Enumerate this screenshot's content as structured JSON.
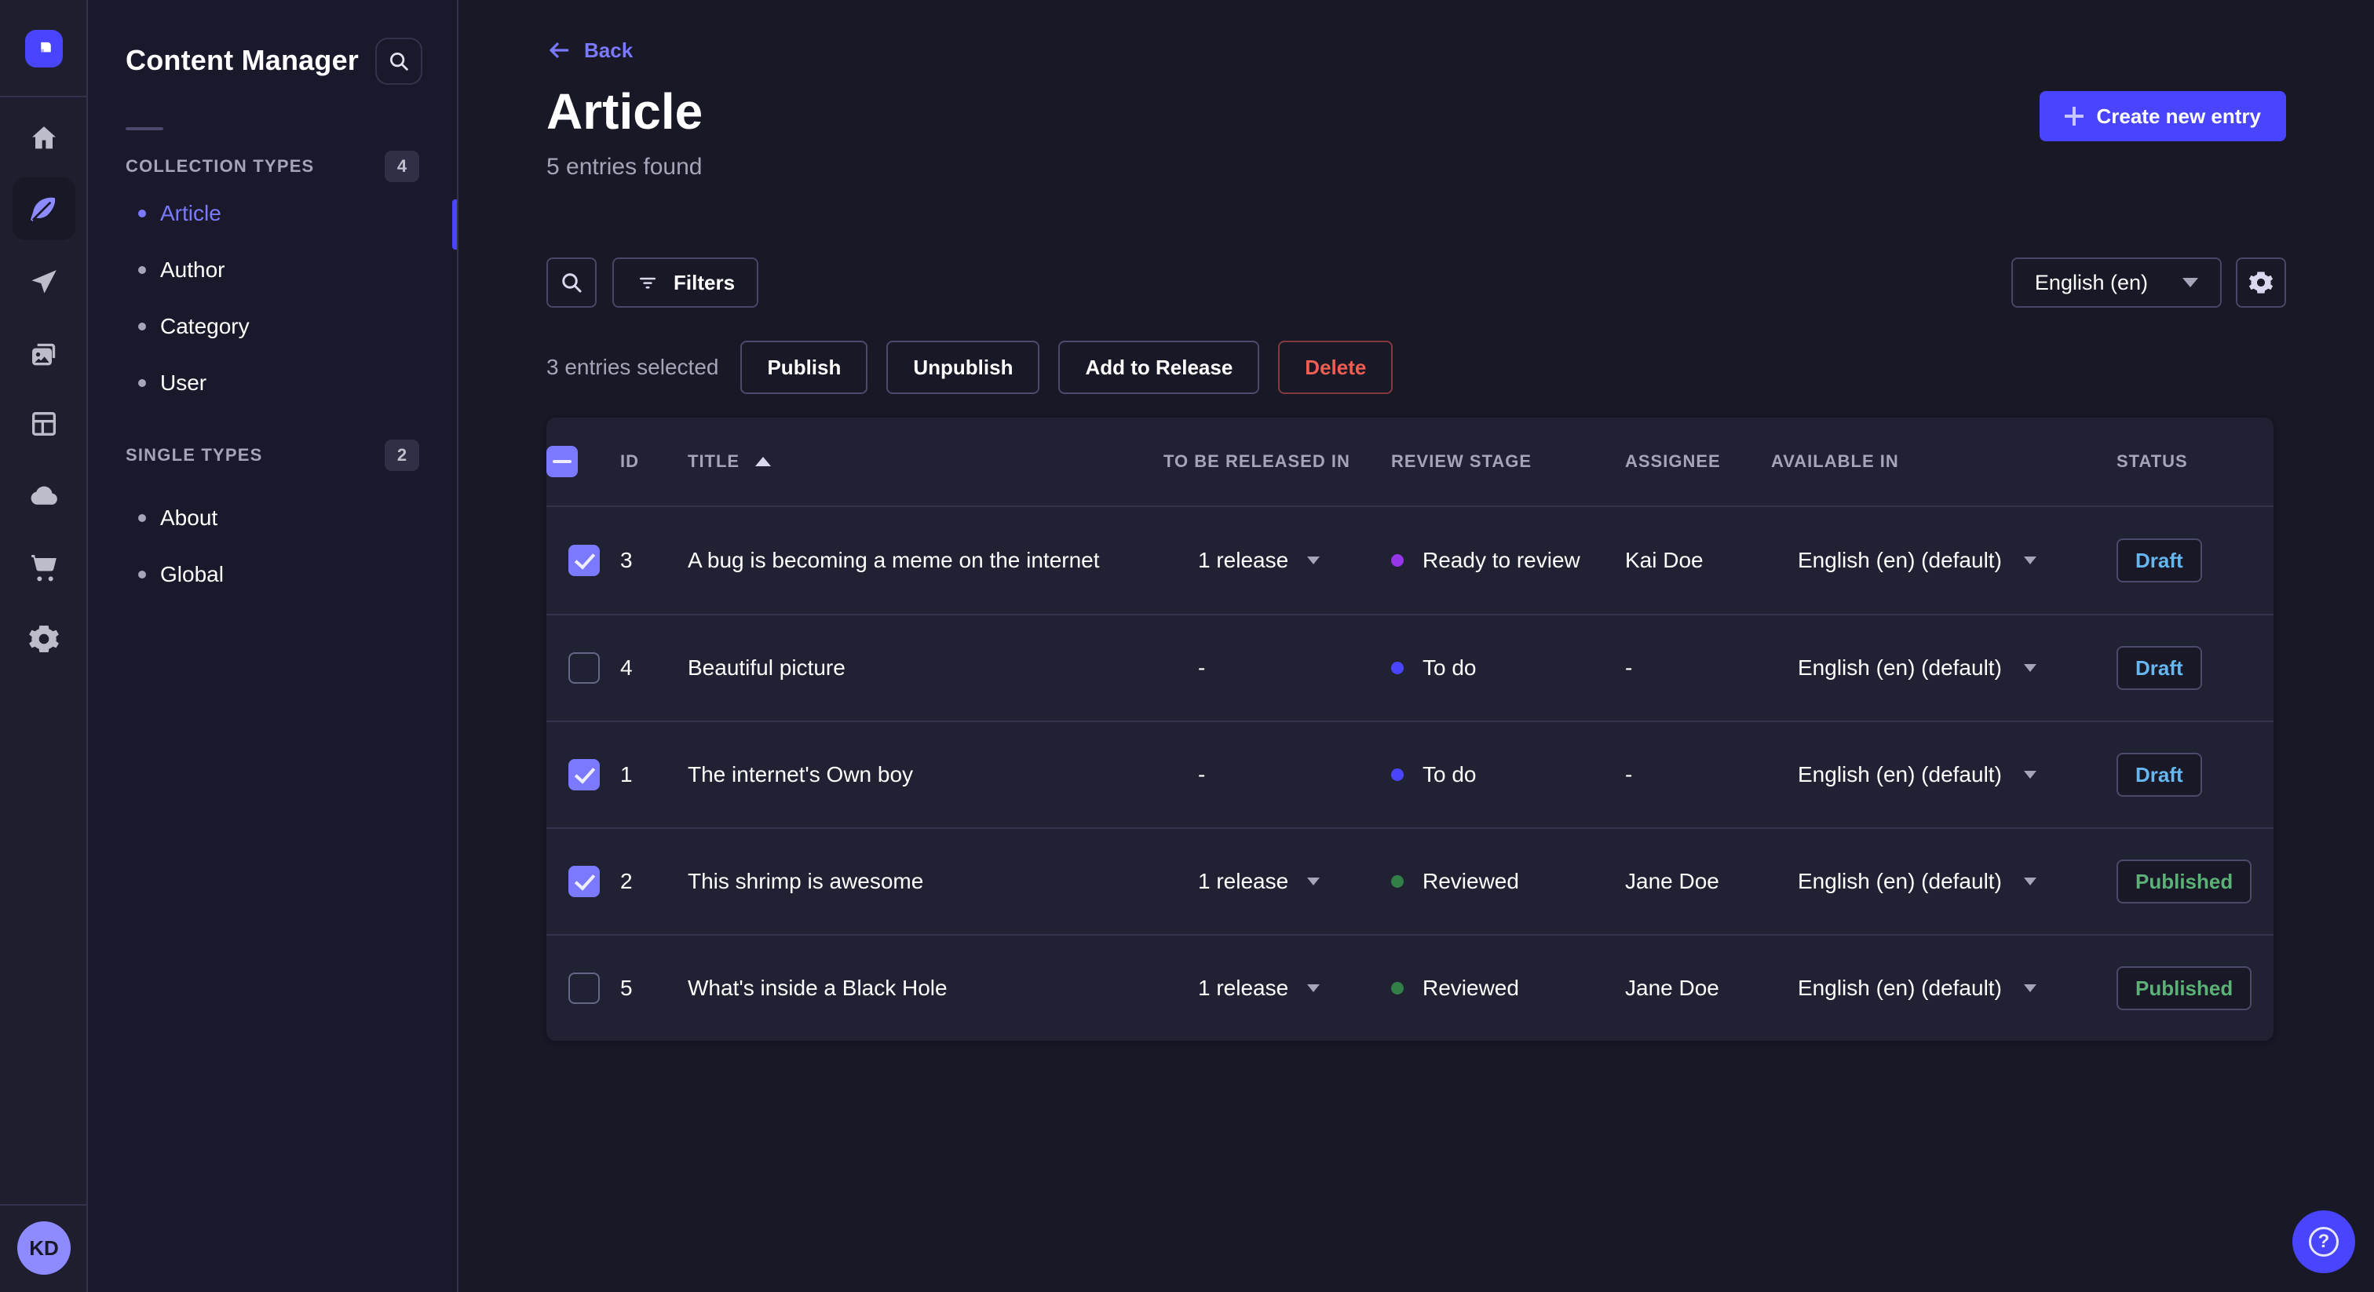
{
  "colors": {
    "accent": "#4945ff",
    "accent_light": "#7b79ff",
    "background": "#181826",
    "surface": "#212134",
    "danger": "#ee5e52",
    "success_text": "#5cb176",
    "draft_text": "#66b7f1",
    "stage_ready_to_review": "#9736e8",
    "stage_todo": "#4945ff",
    "stage_reviewed": "#328048"
  },
  "rail": {
    "icons": [
      "strapi-logo-icon",
      "home-icon",
      "feather-icon",
      "paper-plane-icon",
      "media-library-icon",
      "layout-icon",
      "cloud-icon",
      "cart-icon",
      "gear-icon"
    ],
    "active_icon": "feather-icon",
    "avatar_initials": "KD"
  },
  "sidebar": {
    "title": "Content Manager",
    "search_icon": "search-icon",
    "sections": [
      {
        "label": "COLLECTION TYPES",
        "count": "4",
        "items": [
          {
            "label": "Article",
            "active": true
          },
          {
            "label": "Author",
            "active": false
          },
          {
            "label": "Category",
            "active": false
          },
          {
            "label": "User",
            "active": false
          }
        ]
      },
      {
        "label": "SINGLE TYPES",
        "count": "2",
        "items": [
          {
            "label": "About",
            "active": false
          },
          {
            "label": "Global",
            "active": false
          }
        ]
      }
    ]
  },
  "header": {
    "back_label": "Back",
    "title": "Article",
    "subtitle": "5 entries found",
    "create_label": "Create new entry"
  },
  "toolbar": {
    "filters_label": "Filters",
    "locale_label": "English (en)",
    "settings_icon": "gear-icon"
  },
  "selection": {
    "text": "3 entries selected",
    "actions": [
      {
        "label": "Publish",
        "danger": false
      },
      {
        "label": "Unpublish",
        "danger": false
      },
      {
        "label": "Add to Release",
        "danger": false
      },
      {
        "label": "Delete",
        "danger": true
      }
    ]
  },
  "table": {
    "columns": [
      "ID",
      "TITLE",
      "TO BE RELEASED IN",
      "REVIEW STAGE",
      "ASSIGNEE",
      "AVAILABLE IN",
      "STATUS"
    ],
    "sorted_column": "TITLE",
    "sort_direction": "asc",
    "header_checkbox_state": "indeterminate",
    "rows": [
      {
        "checked": true,
        "id": "3",
        "title": "A bug is becoming a meme on the internet",
        "release": "1 release",
        "stage": "Ready to review",
        "stage_color": "#9736e8",
        "assignee": "Kai Doe",
        "locale": "English (en) (default)",
        "status": "Draft"
      },
      {
        "checked": false,
        "id": "4",
        "title": "Beautiful picture",
        "release": "-",
        "stage": "To do",
        "stage_color": "#4945ff",
        "assignee": "-",
        "locale": "English (en) (default)",
        "status": "Draft"
      },
      {
        "checked": true,
        "id": "1",
        "title": "The internet's Own boy",
        "release": "-",
        "stage": "To do",
        "stage_color": "#4945ff",
        "assignee": "-",
        "locale": "English (en) (default)",
        "status": "Draft"
      },
      {
        "checked": true,
        "id": "2",
        "title": "This shrimp is awesome",
        "release": "1 release",
        "stage": "Reviewed",
        "stage_color": "#328048",
        "assignee": "Jane Doe",
        "locale": "English (en) (default)",
        "status": "Published"
      },
      {
        "checked": false,
        "id": "5",
        "title": "What's inside a Black Hole",
        "release": "1 release",
        "stage": "Reviewed",
        "stage_color": "#328048",
        "assignee": "Jane Doe",
        "locale": "English (en) (default)",
        "status": "Published"
      }
    ]
  },
  "help": {
    "icon": "question-mark-icon"
  }
}
